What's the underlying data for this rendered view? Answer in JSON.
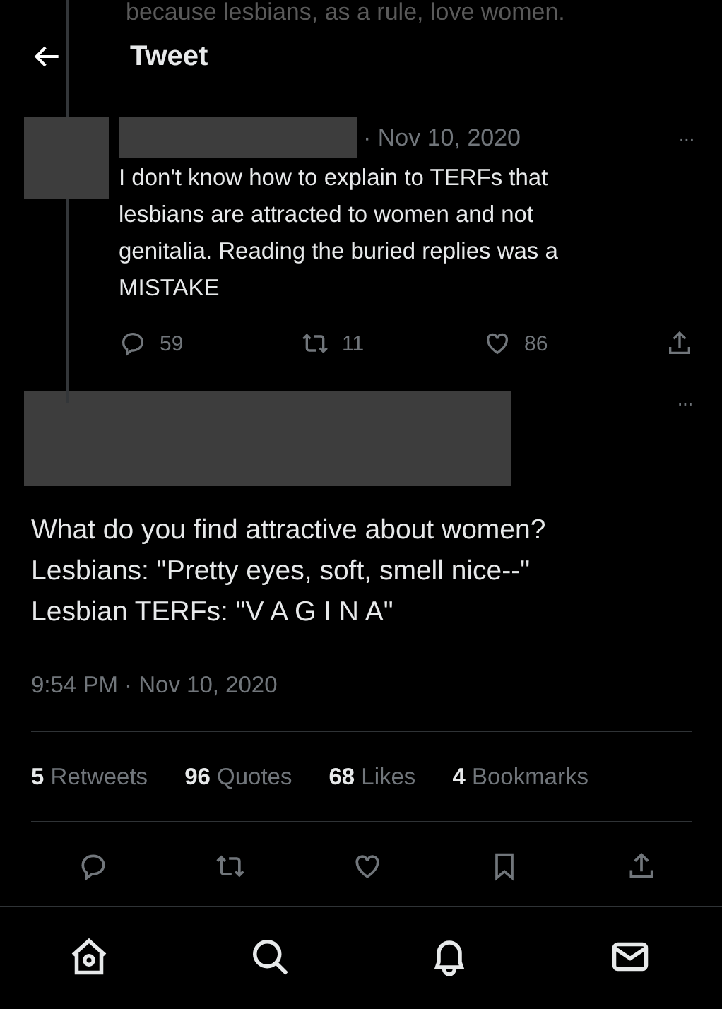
{
  "background_text": "because lesbians, as a rule, love women.",
  "header": {
    "title": "Tweet"
  },
  "reply": {
    "date": "· Nov 10, 2020",
    "more": "···",
    "text": "I don't know how to explain to TERFs that lesbians are attracted to women and not genitalia. Reading the buried replies was a MISTAKE",
    "actions": [
      {
        "kind": "reply",
        "count": "59"
      },
      {
        "kind": "retweet",
        "count": "11"
      },
      {
        "kind": "like",
        "count": "86"
      },
      {
        "kind": "share"
      }
    ]
  },
  "tweet": {
    "more": "···",
    "lines": [
      "What do you find attractive about women?",
      "Lesbians: \"Pretty eyes, soft, smell nice--\"",
      "Lesbian TERFs: \"V A G I N A\""
    ],
    "timestamp": "9:54 PM · Nov 10, 2020",
    "stats": [
      {
        "count": "5",
        "label": "Retweets"
      },
      {
        "count": "96",
        "label": "Quotes"
      },
      {
        "count": "68",
        "label": "Likes"
      },
      {
        "count": "4",
        "label": "Bookmarks"
      }
    ],
    "actions": [
      {
        "kind": "reply"
      },
      {
        "kind": "retweet"
      },
      {
        "kind": "like"
      },
      {
        "kind": "bookmark"
      },
      {
        "kind": "share"
      }
    ]
  },
  "bottom_nav": [
    {
      "kind": "home"
    },
    {
      "kind": "search"
    },
    {
      "kind": "notifications"
    },
    {
      "kind": "messages"
    }
  ]
}
